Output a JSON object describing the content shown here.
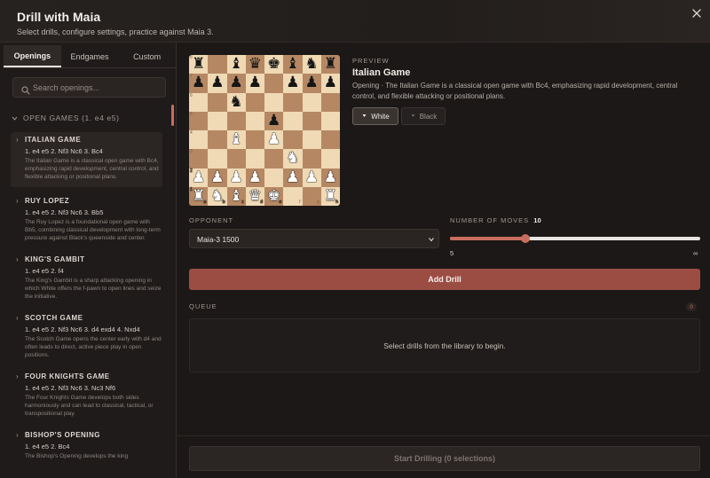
{
  "header": {
    "title": "Drill with Maia",
    "subtitle": "Select drills, configure settings, practice against Maia 3.",
    "close_icon": "close-icon"
  },
  "sidebar": {
    "tabs": [
      {
        "label": "Openings",
        "active": true
      },
      {
        "label": "Endgames",
        "active": false
      },
      {
        "label": "Custom",
        "active": false
      }
    ],
    "search": {
      "placeholder": "Search openings...",
      "value": ""
    },
    "group": {
      "label": "OPEN GAMES (1. e4 e5)"
    },
    "items": [
      {
        "name": "ITALIAN GAME",
        "moves": "1. e4 e5 2. Nf3 Nc6 3. Bc4",
        "desc": "The Italian Game is a classical open game with Bc4, emphasizing rapid development, central control, and flexible attacking or positional plans."
      },
      {
        "name": "RUY LOPEZ",
        "moves": "1. e4 e5 2. Nf3 Nc6 3. Bb5",
        "desc": "The Ruy Lopez is a foundational open game with Bb5, combining classical development with long-term pressure against Black's queenside and center."
      },
      {
        "name": "KING'S GAMBIT",
        "moves": "1. e4 e5 2. f4",
        "desc": "The King's Gambit is a sharp attacking opening in which White offers the f-pawn to open lines and seize the initiative."
      },
      {
        "name": "SCOTCH GAME",
        "moves": "1. e4 e5 2. Nf3 Nc6 3. d4 exd4 4. Nxd4",
        "desc": "The Scotch Game opens the center early with d4 and often leads to direct, active piece play in open positions."
      },
      {
        "name": "FOUR KNIGHTS GAME",
        "moves": "1. e4 e5 2. Nf3 Nc6 3. Nc3 Nf6",
        "desc": "The Four Knights Game develops both sides harmoniously and can lead to classical, tactical, or transpositional play."
      },
      {
        "name": "BISHOP'S OPENING",
        "moves": "1. e4 e5 2. Bc4",
        "desc": "The Bishop's Opening develops the king"
      }
    ]
  },
  "preview": {
    "label": "PREVIEW",
    "name": "Italian Game",
    "desc": "Opening · The Italian Game is a classical open game with Bc4, emphasizing rapid development, central control, and flexible attacking or positional plans.",
    "white_label": "White",
    "black_label": "Black",
    "selected_color": "white"
  },
  "board": {
    "rows": [
      "r.bqkbnr",
      "pppp.ppp",
      "..n.....",
      "....p...",
      "..B.P...",
      ".....N..",
      "PPPP.PPP",
      "RNBQK..R"
    ],
    "rank_labels": [
      "8",
      "7",
      "6",
      "5",
      "4",
      "3",
      "2",
      "1"
    ],
    "file_labels": [
      "a",
      "b",
      "c",
      "d",
      "e",
      "f",
      "g",
      "h"
    ]
  },
  "opponent": {
    "label": "OPPONENT",
    "value": "Maia-3 1500"
  },
  "moves": {
    "label": "NUMBER OF MOVES",
    "value": "10",
    "min_label": "5",
    "max_label": "∞",
    "fraction": 0.3
  },
  "add_button": {
    "label": "Add Drill"
  },
  "queue": {
    "label": "QUEUE",
    "count": "0",
    "empty_text": "Select drills from the library to begin."
  },
  "start_button": {
    "label": "Start Drilling (0 selections)"
  },
  "colors": {
    "accent": "#c96d5e",
    "button": "#9b4d43",
    "board_light": "#f0d9b5",
    "board_dark": "#b58863"
  }
}
